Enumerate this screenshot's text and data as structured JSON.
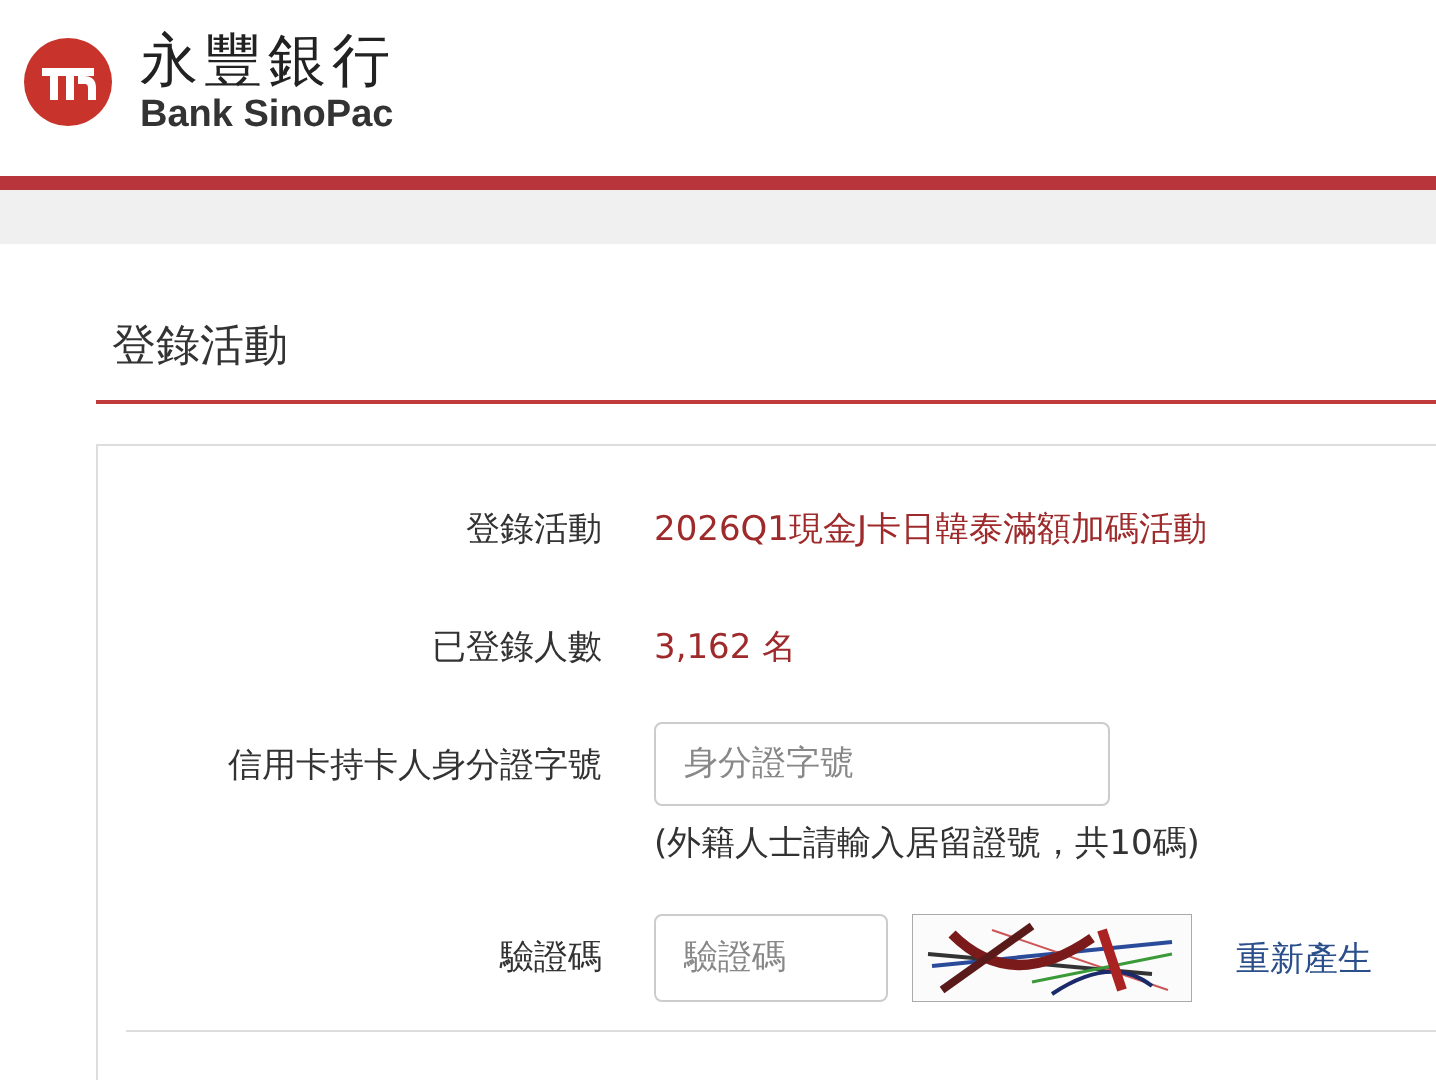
{
  "header": {
    "brand_name": "永豐銀行",
    "brand_name_en": "Bank SinoPac"
  },
  "page_title": "登錄活動",
  "form": {
    "rows": [
      {
        "kind": "text",
        "label": "登錄活動",
        "value": "2026Q1現金J卡日韓泰滿額加碼活動"
      },
      {
        "kind": "text",
        "label": "已登錄人數",
        "value": "3,162 名"
      },
      {
        "kind": "input",
        "label": "信用卡持卡人身分證字號",
        "placeholder": "身分證字號",
        "hint": "(外籍人士請輸入居留證號，共10碼)"
      },
      {
        "kind": "captcha",
        "label": "驗證碼",
        "placeholder": "驗證碼",
        "link": "重新產生"
      }
    ]
  }
}
